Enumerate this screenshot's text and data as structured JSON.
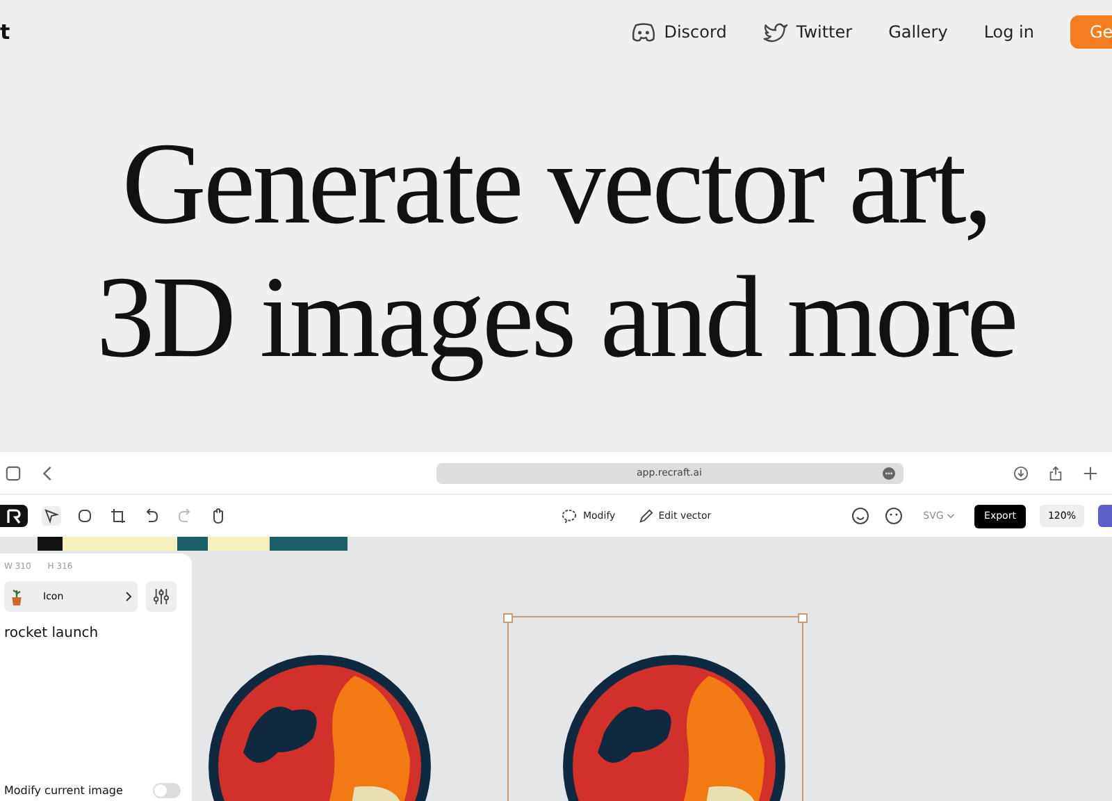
{
  "nav": {
    "logo_fragment": "t",
    "links": [
      {
        "kind": "discord",
        "label": "Discord"
      },
      {
        "kind": "twitter",
        "label": "Twitter"
      },
      {
        "kind": "plain",
        "label": "Gallery"
      },
      {
        "kind": "plain",
        "label": "Log in"
      }
    ],
    "cta": "Ge"
  },
  "headline": [
    "Generate vector art,",
    "3D images and more"
  ],
  "browser": {
    "url": "app.recraft.ai"
  },
  "toolbar": {
    "center": [
      {
        "kind": "modify",
        "label": "Modify"
      },
      {
        "kind": "edit",
        "label": "Edit vector"
      }
    ],
    "format": "SVG",
    "export": "Export",
    "zoom": "120%"
  },
  "panel": {
    "width": "W 310",
    "height": "H 316",
    "style": "Icon",
    "prompt": "rocket launch",
    "toggle": {
      "label": "Modify current image",
      "on": false
    }
  }
}
